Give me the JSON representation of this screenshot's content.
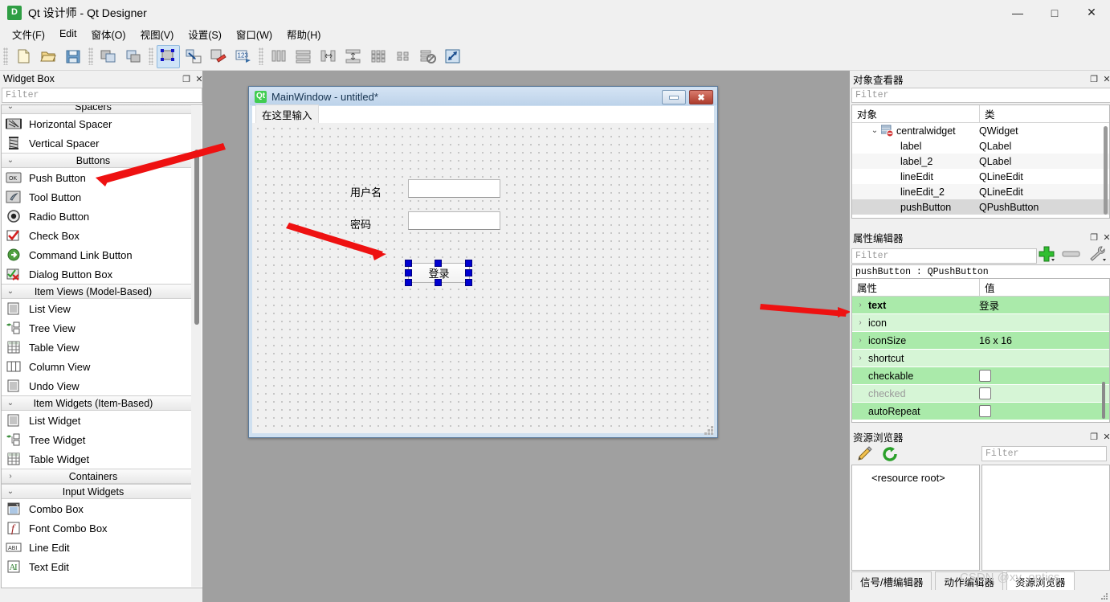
{
  "window": {
    "title": "Qt 设计师 - Qt Designer",
    "app_icon": "D",
    "minimize": "—",
    "maximize": "□",
    "close": "✕"
  },
  "menubar": {
    "items": [
      {
        "label": "文件(F)",
        "mnemonic": "F"
      },
      {
        "label": "Edit",
        "mnemonic": "E"
      },
      {
        "label": "窗体(O)",
        "mnemonic": "O"
      },
      {
        "label": "视图(V)",
        "mnemonic": "V"
      },
      {
        "label": "设置(S)",
        "mnemonic": "S"
      },
      {
        "label": "窗口(W)",
        "mnemonic": "W"
      },
      {
        "label": "帮助(H)",
        "mnemonic": "H"
      }
    ]
  },
  "toolbar": {
    "groups": [
      [
        "new-file-icon",
        "open-file-icon",
        "save-icon"
      ],
      [
        "copy-widget-icon",
        "paste-widget-icon"
      ],
      [
        "edit-widgets-icon",
        "edit-signals-slots-icon",
        "edit-buddies-icon",
        "edit-tab-order-icon"
      ],
      [
        "layout-horizontally-icon",
        "layout-vertically-icon",
        "layout-splitter-h-icon",
        "layout-splitter-v-icon",
        "layout-grid-icon",
        "layout-form-icon",
        "break-layout-icon",
        "adjust-size-icon"
      ]
    ],
    "active_index": "edit-widgets-icon"
  },
  "widget_box": {
    "title": "Widget Box",
    "filter_placeholder": "Filter",
    "undock_glyph": "❐",
    "close_glyph": "✕",
    "groups": [
      {
        "name": "Spacers",
        "expanded": true,
        "arrow": "⌄",
        "items": [
          {
            "label": "Horizontal Spacer",
            "icon": "horizontal-spacer-icon"
          },
          {
            "label": "Vertical Spacer",
            "icon": "vertical-spacer-icon"
          }
        ]
      },
      {
        "name": "Buttons",
        "expanded": true,
        "arrow": "⌄",
        "items": [
          {
            "label": "Push Button",
            "icon": "push-button-icon"
          },
          {
            "label": "Tool Button",
            "icon": "tool-button-icon"
          },
          {
            "label": "Radio Button",
            "icon": "radio-button-icon"
          },
          {
            "label": "Check Box",
            "icon": "check-box-icon"
          },
          {
            "label": "Command Link Button",
            "icon": "command-link-button-icon"
          },
          {
            "label": "Dialog Button Box",
            "icon": "dialog-button-box-icon"
          }
        ]
      },
      {
        "name": "Item Views (Model-Based)",
        "expanded": true,
        "arrow": "⌄",
        "items": [
          {
            "label": "List View",
            "icon": "list-view-icon"
          },
          {
            "label": "Tree View",
            "icon": "tree-view-icon"
          },
          {
            "label": "Table View",
            "icon": "table-view-icon"
          },
          {
            "label": "Column View",
            "icon": "column-view-icon"
          },
          {
            "label": "Undo View",
            "icon": "undo-view-icon"
          }
        ]
      },
      {
        "name": "Item Widgets (Item-Based)",
        "expanded": true,
        "arrow": "⌄",
        "items": [
          {
            "label": "List Widget",
            "icon": "list-widget-icon"
          },
          {
            "label": "Tree Widget",
            "icon": "tree-widget-icon"
          },
          {
            "label": "Table Widget",
            "icon": "table-widget-icon"
          }
        ]
      },
      {
        "name": "Containers",
        "expanded": false,
        "arrow": "›",
        "items": []
      },
      {
        "name": "Input Widgets",
        "expanded": true,
        "arrow": "⌄",
        "items": [
          {
            "label": "Combo Box",
            "icon": "combo-box-icon"
          },
          {
            "label": "Font Combo Box",
            "icon": "font-combo-box-icon"
          },
          {
            "label": "Line Edit",
            "icon": "line-edit-icon"
          },
          {
            "label": "Text Edit",
            "icon": "text-edit-icon"
          }
        ]
      }
    ]
  },
  "form": {
    "title": "MainWindow - untitled*",
    "logo_text": "Qt",
    "minimize_glyph": "",
    "close_glyph": "✖",
    "menubar_placeholder": "在这里输入",
    "labels": [
      {
        "name": "label",
        "text": "用户名"
      },
      {
        "name": "label_2",
        "text": "密码"
      }
    ],
    "push_button": {
      "text": "登录",
      "selected": true
    }
  },
  "object_inspector": {
    "title": "对象查看器",
    "filter_placeholder": "Filter",
    "undock_glyph": "❐",
    "close_glyph": "✕",
    "columns": [
      "对象",
      "类"
    ],
    "rows": [
      {
        "object": "centralwidget",
        "class": "QWidget",
        "depth": 0,
        "expandable": true,
        "arrow": "⌄",
        "icon": "central-widget-icon",
        "selected": false
      },
      {
        "object": "label",
        "class": "QLabel",
        "depth": 1,
        "expandable": false,
        "arrow": "",
        "icon": "",
        "selected": false
      },
      {
        "object": "label_2",
        "class": "QLabel",
        "depth": 1,
        "expandable": false,
        "arrow": "",
        "icon": "",
        "selected": false
      },
      {
        "object": "lineEdit",
        "class": "QLineEdit",
        "depth": 1,
        "expandable": false,
        "arrow": "",
        "icon": "",
        "selected": false
      },
      {
        "object": "lineEdit_2",
        "class": "QLineEdit",
        "depth": 1,
        "expandable": false,
        "arrow": "",
        "icon": "",
        "selected": false
      },
      {
        "object": "pushButton",
        "class": "QPushButton",
        "depth": 1,
        "expandable": false,
        "arrow": "",
        "icon": "",
        "selected": true
      }
    ]
  },
  "property_editor": {
    "title": "属性编辑器",
    "filter_placeholder": "Filter",
    "undock_glyph": "❐",
    "close_glyph": "✕",
    "add_glyph": "＋",
    "remove_glyph": "▬",
    "configure_glyph": "🔧",
    "object_line": "pushButton : QPushButton",
    "columns": [
      "属性",
      "值"
    ],
    "rows": [
      {
        "property": "text",
        "value": "登录",
        "expandable": true,
        "arrow": "›",
        "bold": true,
        "type": "text",
        "highlight": "dark",
        "disabled": false
      },
      {
        "property": "icon",
        "value": "",
        "expandable": true,
        "arrow": "›",
        "bold": false,
        "type": "text",
        "highlight": "light",
        "disabled": false
      },
      {
        "property": "iconSize",
        "value": "16 x 16",
        "expandable": true,
        "arrow": "›",
        "bold": false,
        "type": "text",
        "highlight": "light",
        "disabled": false
      },
      {
        "property": "shortcut",
        "value": "",
        "expandable": true,
        "arrow": "›",
        "bold": false,
        "type": "text",
        "highlight": "light",
        "disabled": false
      },
      {
        "property": "checkable",
        "value": "",
        "expandable": false,
        "arrow": "",
        "bold": false,
        "type": "checkbox",
        "highlight": "dark",
        "disabled": false
      },
      {
        "property": "checked",
        "value": "",
        "expandable": false,
        "arrow": "",
        "bold": false,
        "type": "checkbox",
        "highlight": "light",
        "disabled": true
      },
      {
        "property": "autoRepeat",
        "value": "",
        "expandable": false,
        "arrow": "",
        "bold": false,
        "type": "checkbox",
        "highlight": "dark",
        "disabled": false
      }
    ],
    "colors": {
      "row_dark": "#aaeaaa",
      "row_light": "#d6f5d6"
    }
  },
  "resource_browser": {
    "title": "资源浏览器",
    "undock_glyph": "❐",
    "close_glyph": "✕",
    "edit_glyph": "✏",
    "reload_glyph": "⟳",
    "filter_placeholder": "Filter",
    "root_label": "<resource root>",
    "tabs": [
      {
        "label": "信号/槽编辑器",
        "active": false
      },
      {
        "label": "动作编辑器",
        "active": false
      },
      {
        "label": "资源浏览器",
        "active": true
      }
    ]
  },
  "watermark": "CSDN @xy_optics"
}
